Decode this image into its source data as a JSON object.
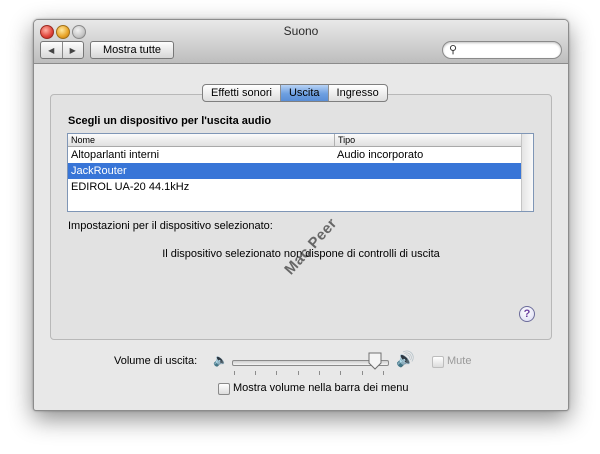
{
  "window": {
    "title": "Suono"
  },
  "toolbar": {
    "back_glyph": "◀",
    "forward_glyph": "▶",
    "show_all_label": "Mostra tutte",
    "search_value": "",
    "search_icon": "magnifier-icon"
  },
  "tabs": [
    {
      "label": "Effetti sonori",
      "active": false
    },
    {
      "label": "Uscita",
      "active": true
    },
    {
      "label": "Ingresso",
      "active": false
    }
  ],
  "output": {
    "heading": "Scegli un dispositivo per l'uscita audio",
    "columns": {
      "name": "Nome",
      "type": "Tipo"
    },
    "devices": [
      {
        "name": "Altoparlanti interni",
        "type": "Audio incorporato",
        "selected": false
      },
      {
        "name": "JackRouter",
        "type": "",
        "selected": true
      },
      {
        "name": "EDIROL UA-20 44.1kHz",
        "type": "",
        "selected": false
      }
    ],
    "settings_label": "Impostazioni per il dispositivo selezionato:",
    "no_controls_message": "Il dispositivo selezionato non dispone di controlli di uscita",
    "help_glyph": "?"
  },
  "volume": {
    "label": "Volume di uscita:",
    "level": 0.92,
    "mute_label": "Mute",
    "mute_checked": false,
    "mute_enabled": false,
    "menu_bar_label": "Mostra volume nella barra dei menu",
    "menu_bar_checked": false
  },
  "watermark": "Mac Peer",
  "colors": {
    "selection": "#3875d7",
    "active_tab": "#6d9fe0"
  }
}
